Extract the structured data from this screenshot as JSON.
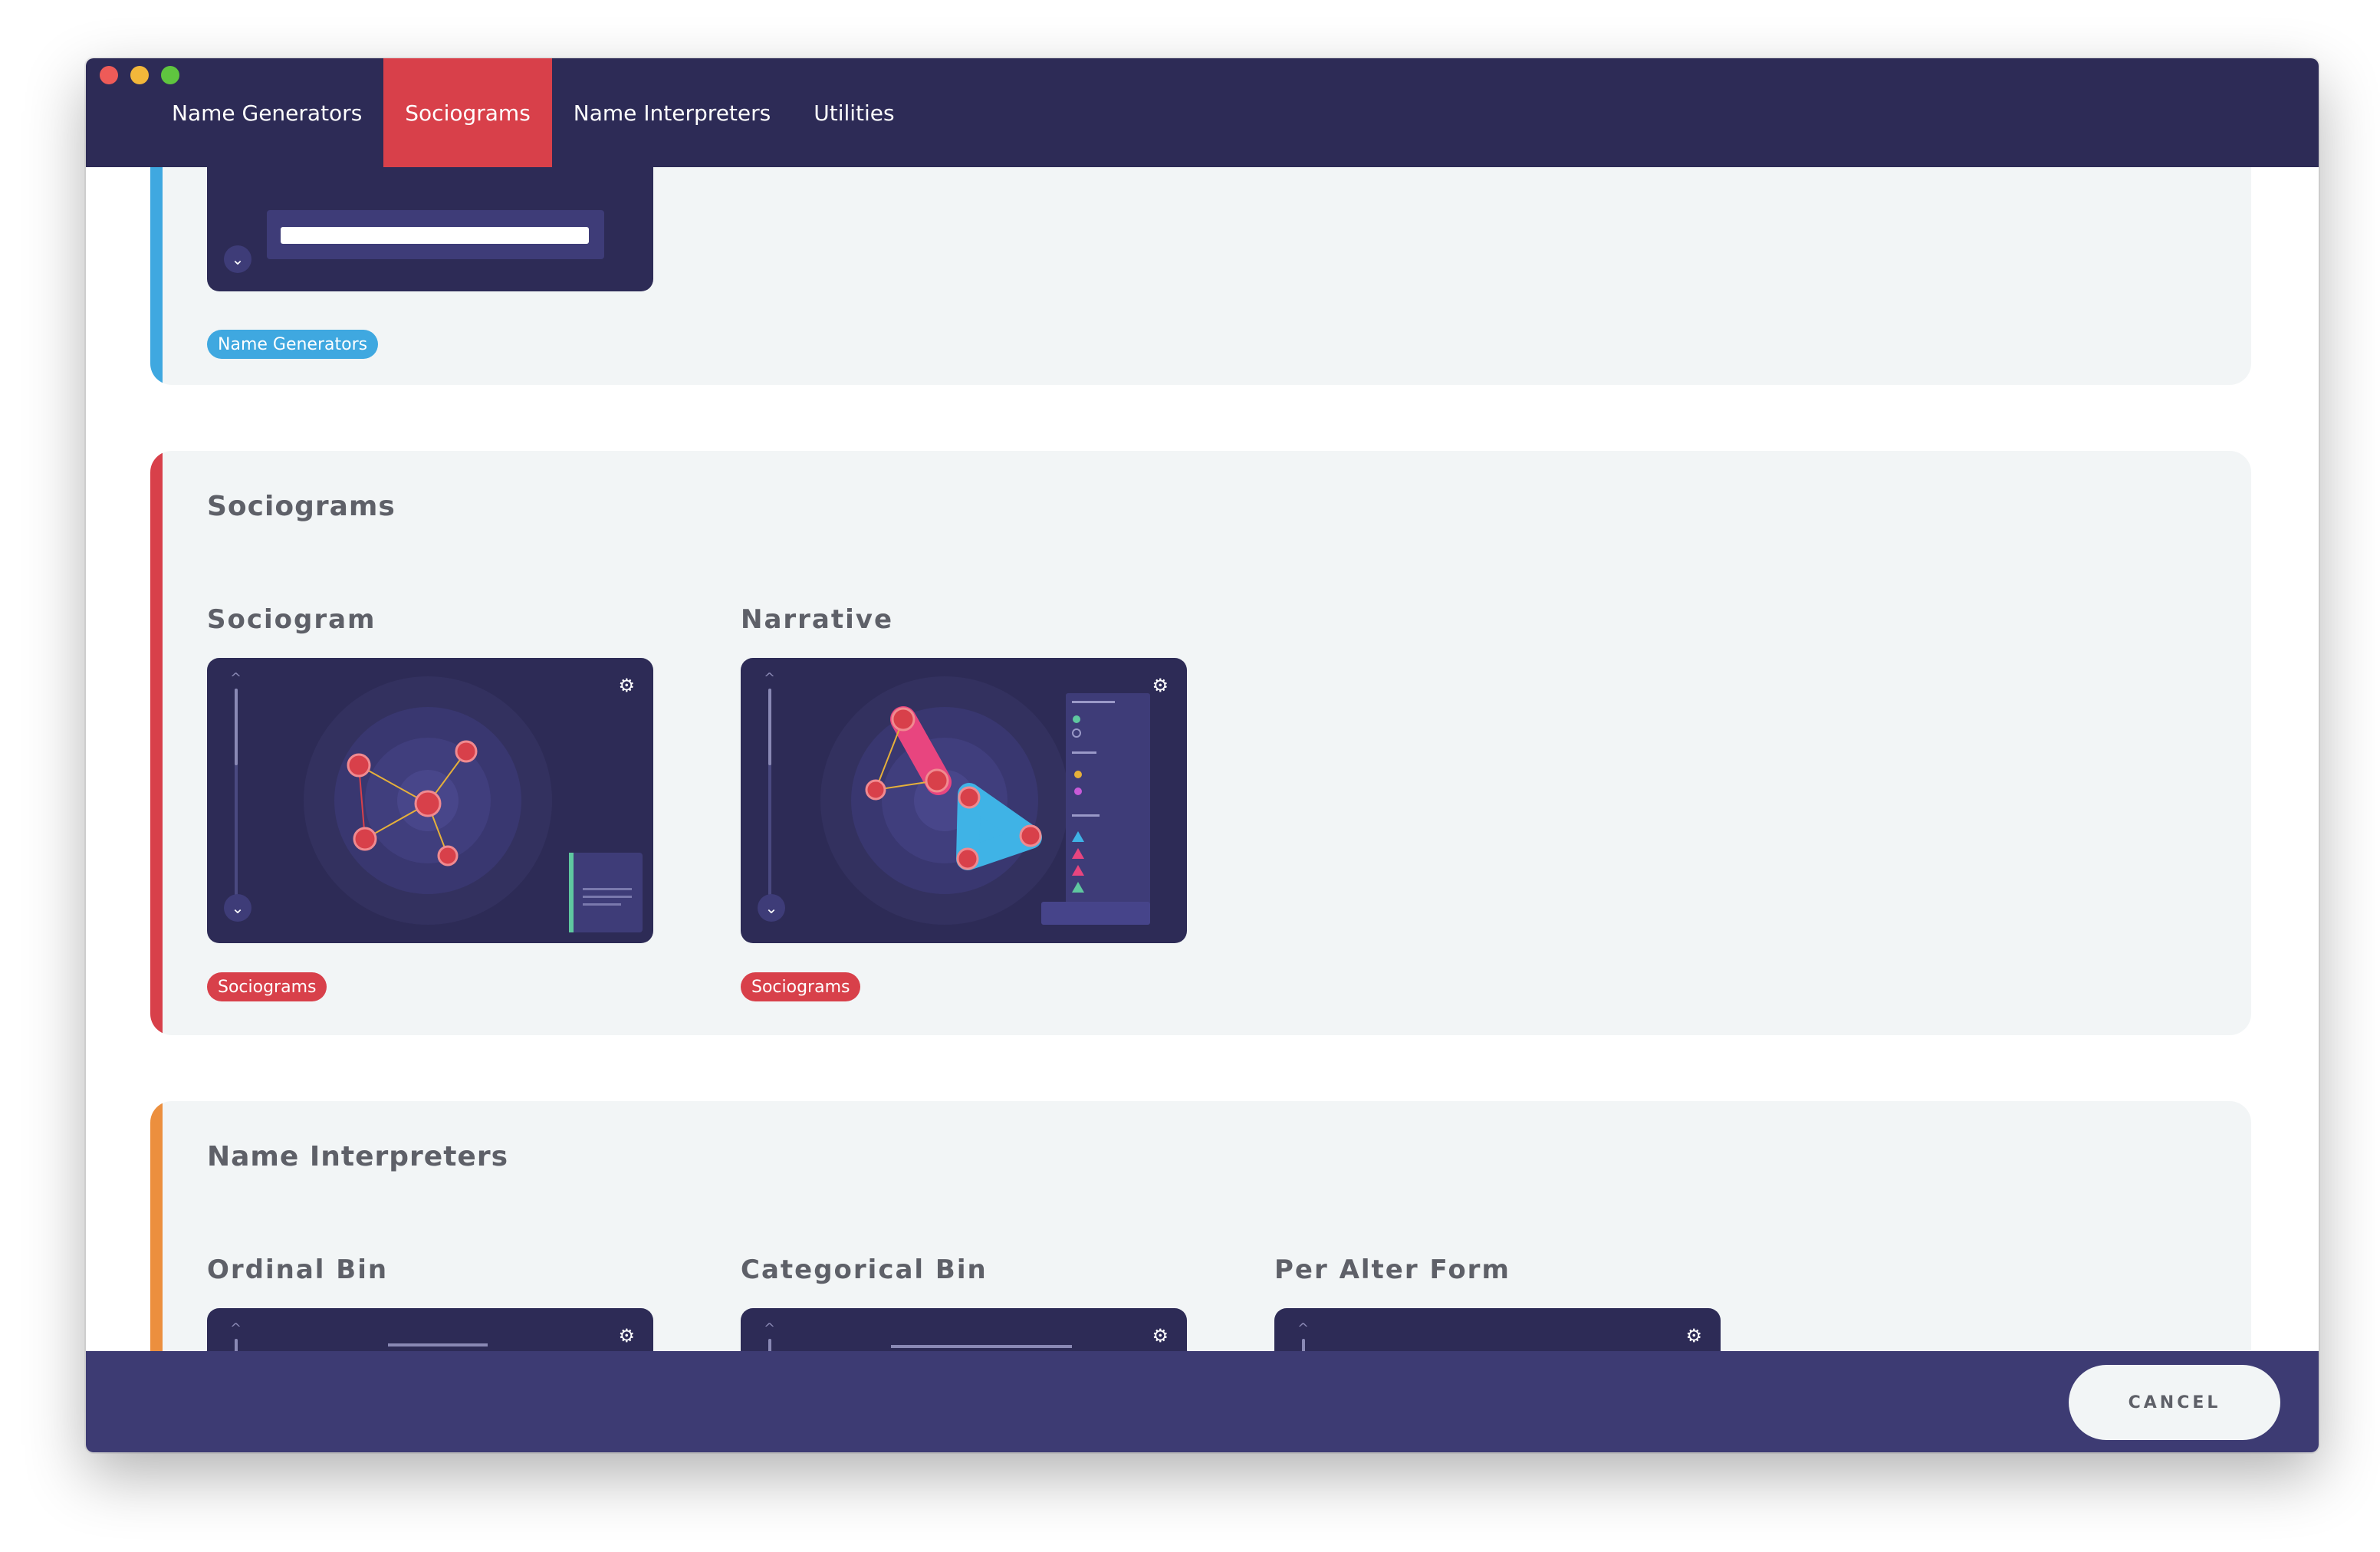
{
  "nav": {
    "tabs": [
      {
        "label": "Name Generators"
      },
      {
        "label": "Sociograms"
      },
      {
        "label": "Name Interpreters"
      },
      {
        "label": "Utilities"
      }
    ],
    "active_tab": "Sociograms"
  },
  "sections": {
    "name_generators": {
      "badge": "Name Generators",
      "color": "#3fa8e0"
    },
    "sociograms": {
      "title": "Sociograms",
      "color": "#d8404a",
      "cards": [
        {
          "title": "Sociogram",
          "badge": "Sociograms"
        },
        {
          "title": "Narrative",
          "badge": "Sociograms"
        }
      ]
    },
    "name_interpreters": {
      "title": "Name Interpreters",
      "color": "#ec8f3e",
      "cards": [
        {
          "title": "Ordinal Bin"
        },
        {
          "title": "Categorical Bin"
        },
        {
          "title": "Per Alter Form"
        }
      ]
    }
  },
  "footer": {
    "cancel_label": "CANCEL"
  },
  "colors": {
    "nav_bg": "#2d2b56",
    "active_tab": "#d8404a",
    "footer_bg": "#3d3b73",
    "node": "#d8404a",
    "edge": "#e6b03a"
  }
}
